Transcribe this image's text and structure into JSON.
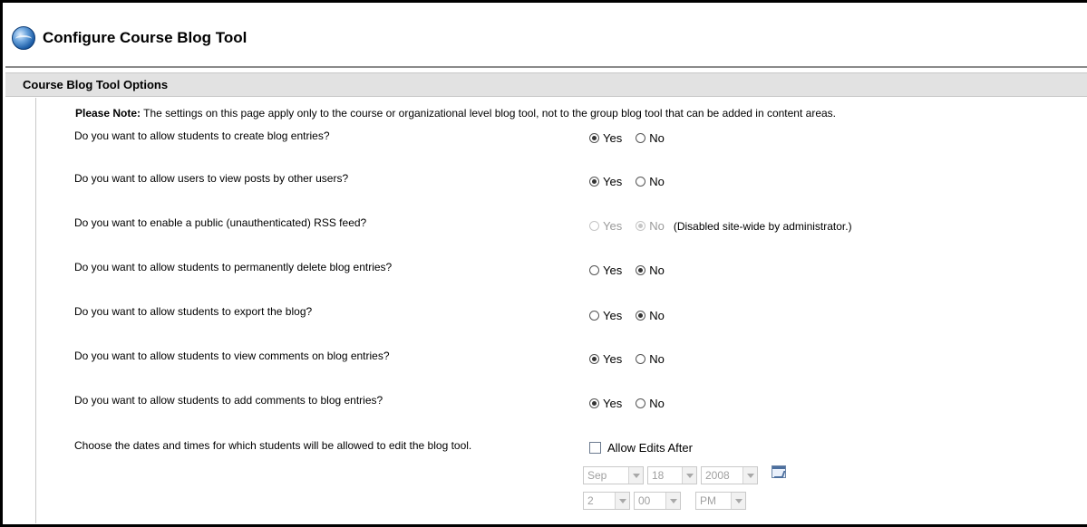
{
  "page": {
    "title": "Configure Course Blog Tool",
    "section_header": "Course Blog Tool Options",
    "note_label": "Please Note:",
    "note_text": " The settings on this page apply only to the course or organizational level blog tool, not to the group blog tool that can be added in content areas."
  },
  "questions": [
    {
      "text": "Do you want to allow students to create blog entries?",
      "yes": "Yes",
      "no": "No",
      "selected": "yes"
    },
    {
      "text": "Do you want to allow users to view posts by other users?",
      "yes": "Yes",
      "no": "No",
      "selected": "yes"
    },
    {
      "text": "Do you want to enable a public (unauthenticated) RSS feed?",
      "yes": "Yes",
      "no": "No",
      "selected": "no",
      "disabled": true,
      "disabled_note": "(Disabled site-wide by administrator.)"
    },
    {
      "text": "Do you want to allow students to permanently delete blog entries?",
      "yes": "Yes",
      "no": "No",
      "selected": "no"
    },
    {
      "text": "Do you want to allow students to export the blog?",
      "yes": "Yes",
      "no": "No",
      "selected": "no"
    },
    {
      "text": "Do you want to allow students to view comments on blog entries?",
      "yes": "Yes",
      "no": "No",
      "selected": "yes"
    },
    {
      "text": "Do you want to allow students to add comments to blog entries?",
      "yes": "Yes",
      "no": "No",
      "selected": "yes"
    }
  ],
  "edit_dates": {
    "question": "Choose the dates and times for which students will be allowed to edit the blog tool.",
    "checkbox_label": "Allow Edits After",
    "checked": false,
    "month": "Sep",
    "day": "18",
    "year": "2008",
    "hour": "2",
    "minute": "00",
    "ampm": "PM"
  },
  "icons": {
    "title": "globe-icon",
    "calendar": "calendar-icon"
  },
  "colors": {
    "section_header_bg": "#e2e2e2",
    "disabled_text": "#9a9a9a"
  }
}
